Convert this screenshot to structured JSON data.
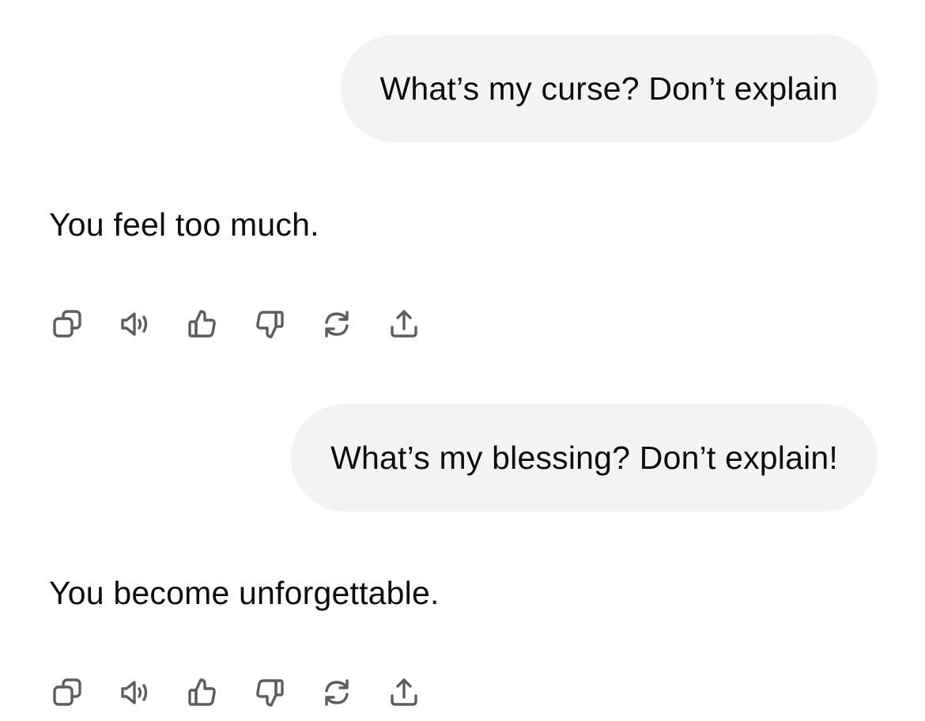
{
  "conversation": {
    "messages": [
      {
        "role": "user",
        "text": "What’s my curse? Don’t explain"
      },
      {
        "role": "assistant",
        "text": "You feel too much."
      },
      {
        "role": "user",
        "text": "What’s my blessing? Don’t explain!"
      },
      {
        "role": "assistant",
        "text": "You become unforgettable."
      }
    ]
  },
  "message_actions": [
    {
      "name": "copy",
      "icon": "copy-icon"
    },
    {
      "name": "read-aloud",
      "icon": "speaker-icon"
    },
    {
      "name": "good-response",
      "icon": "thumbs-up-icon"
    },
    {
      "name": "bad-response",
      "icon": "thumbs-down-icon"
    },
    {
      "name": "regenerate",
      "icon": "refresh-icon"
    },
    {
      "name": "share",
      "icon": "share-icon"
    }
  ],
  "colors": {
    "user_bubble_bg": "#f3f3f3",
    "text": "#0d0d0d",
    "icon": "#5d5d5d",
    "background": "#ffffff"
  }
}
